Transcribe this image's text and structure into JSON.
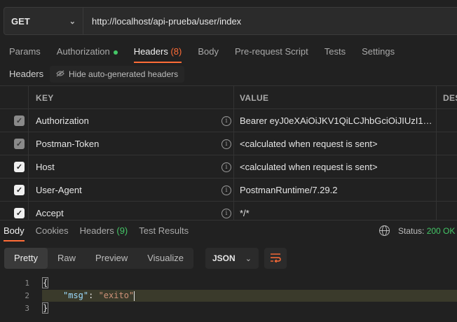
{
  "request": {
    "method": "GET",
    "url": "http://localhost/api-prueba/user/index"
  },
  "tabs": [
    {
      "label": "Params"
    },
    {
      "label": "Authorization"
    },
    {
      "label": "Headers",
      "count": "(8)"
    },
    {
      "label": "Body"
    },
    {
      "label": "Pre-request Script"
    },
    {
      "label": "Tests"
    },
    {
      "label": "Settings"
    }
  ],
  "headers_section": {
    "label": "Headers",
    "hide_auto": "Hide auto-generated headers"
  },
  "table": {
    "columns": [
      "KEY",
      "VALUE",
      "DES"
    ],
    "rows": [
      {
        "key": "Authorization",
        "value": "Bearer eyJ0eXAiOiJKV1QiLCJhbGciOiJIUzI1NiJ...",
        "checked": true,
        "auto": true
      },
      {
        "key": "Postman-Token",
        "value": "<calculated when request is sent>",
        "checked": true,
        "auto": true
      },
      {
        "key": "Host",
        "value": "<calculated when request is sent>",
        "checked": true,
        "auto": false
      },
      {
        "key": "User-Agent",
        "value": "PostmanRuntime/7.29.2",
        "checked": true,
        "auto": false
      },
      {
        "key": "Accept",
        "value": "*/*",
        "checked": true,
        "auto": false
      }
    ]
  },
  "response": {
    "tabs": [
      {
        "label": "Body"
      },
      {
        "label": "Cookies"
      },
      {
        "label": "Headers",
        "count": "(9)"
      },
      {
        "label": "Test Results"
      }
    ],
    "status_label": "Status:",
    "status_value": "200 OK",
    "views": [
      "Pretty",
      "Raw",
      "Preview",
      "Visualize"
    ],
    "format": "JSON",
    "lines": [
      "1",
      "2",
      "3"
    ],
    "body": {
      "open": "{",
      "key": "\"msg\"",
      "sep": ": ",
      "value": "\"exito\"",
      "close": "}"
    }
  },
  "colors": {
    "accent": "#ff6c37",
    "success": "#44c767",
    "background": "#212121"
  },
  "icons": [
    "chevron-down-icon",
    "eye-off-icon",
    "info-icon",
    "globe-icon",
    "wrap-lines-icon",
    "checkbox-icon"
  ]
}
